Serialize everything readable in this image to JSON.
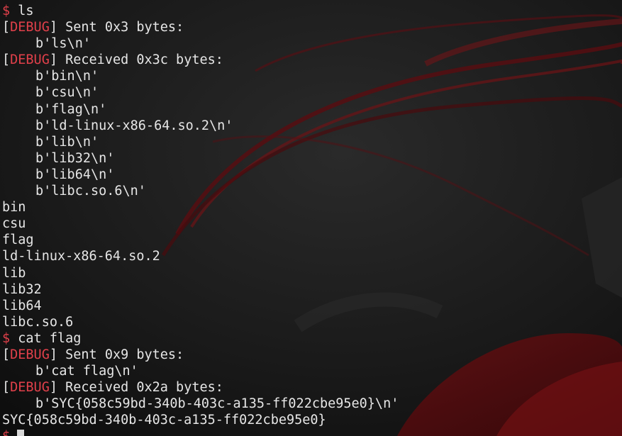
{
  "terminal": {
    "prompt_symbol": "$",
    "debug_label": "DEBUG",
    "lines": [
      {
        "type": "prompt",
        "text": "ls"
      },
      {
        "type": "debug",
        "text": "Sent 0x3 bytes:"
      },
      {
        "type": "indent",
        "text": "b'ls\\n'"
      },
      {
        "type": "debug",
        "text": "Received 0x3c bytes:"
      },
      {
        "type": "indent",
        "text": "b'bin\\n'"
      },
      {
        "type": "indent",
        "text": "b'csu\\n'"
      },
      {
        "type": "indent",
        "text": "b'flag\\n'"
      },
      {
        "type": "indent",
        "text": "b'ld-linux-x86-64.so.2\\n'"
      },
      {
        "type": "indent",
        "text": "b'lib\\n'"
      },
      {
        "type": "indent",
        "text": "b'lib32\\n'"
      },
      {
        "type": "indent",
        "text": "b'lib64\\n'"
      },
      {
        "type": "indent",
        "text": "b'libc.so.6\\n'"
      },
      {
        "type": "plain",
        "text": "bin"
      },
      {
        "type": "plain",
        "text": "csu"
      },
      {
        "type": "plain",
        "text": "flag"
      },
      {
        "type": "plain",
        "text": "ld-linux-x86-64.so.2"
      },
      {
        "type": "plain",
        "text": "lib"
      },
      {
        "type": "plain",
        "text": "lib32"
      },
      {
        "type": "plain",
        "text": "lib64"
      },
      {
        "type": "plain",
        "text": "libc.so.6"
      },
      {
        "type": "prompt",
        "text": "cat flag"
      },
      {
        "type": "debug",
        "text": "Sent 0x9 bytes:"
      },
      {
        "type": "indent",
        "text": "b'cat flag\\n'"
      },
      {
        "type": "debug",
        "text": "Received 0x2a bytes:"
      },
      {
        "type": "indent",
        "text": "b'SYC{058c59bd-340b-403c-a135-ff022cbe95e0}\\n'"
      },
      {
        "type": "plain",
        "text": "SYC{058c59bd-340b-403c-a135-ff022cbe95e0}"
      },
      {
        "type": "cursor",
        "text": ""
      }
    ]
  },
  "colors": {
    "prompt": "#e0404a",
    "debug": "#e0404a",
    "text": "#e6e6e6",
    "background": "#141414"
  }
}
